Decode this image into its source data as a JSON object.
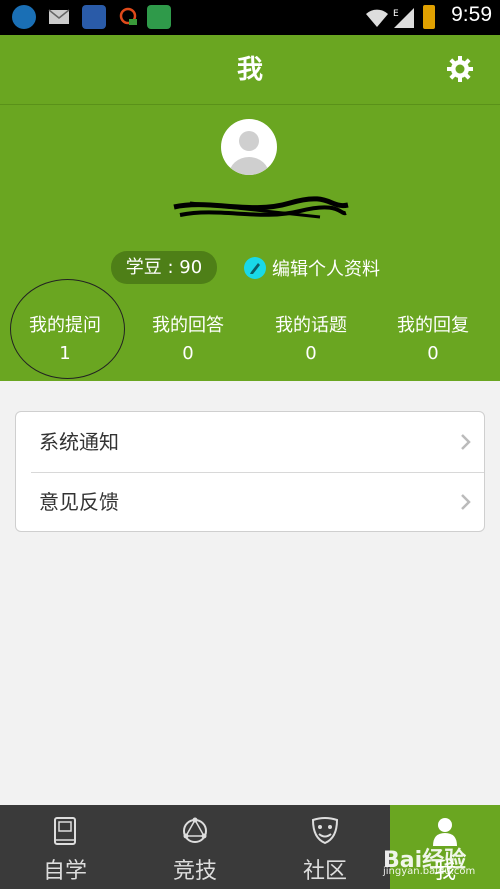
{
  "status_bar": {
    "time": "9:59"
  },
  "header": {
    "title": "我"
  },
  "profile": {
    "bean_label": "学豆 : 90",
    "edit_label": "编辑个人资料"
  },
  "stats": [
    {
      "label": "我的提问",
      "value": "1"
    },
    {
      "label": "我的回答",
      "value": "0"
    },
    {
      "label": "我的话题",
      "value": "0"
    },
    {
      "label": "我的回复",
      "value": "0"
    }
  ],
  "menu": [
    {
      "label": "系统通知"
    },
    {
      "label": "意见反馈"
    }
  ],
  "tabs": [
    {
      "label": "自学",
      "icon": "book-icon"
    },
    {
      "label": "竞技",
      "icon": "network-icon"
    },
    {
      "label": "社区",
      "icon": "masks-icon"
    },
    {
      "label": "我",
      "icon": "person-icon"
    }
  ],
  "watermark": {
    "main": "Bai经验",
    "sub": "jingyan.baidu.com"
  },
  "colors": {
    "accent": "#6aa621",
    "tabbar": "#3a3a3a",
    "edit_icon": "#19d9e8"
  }
}
